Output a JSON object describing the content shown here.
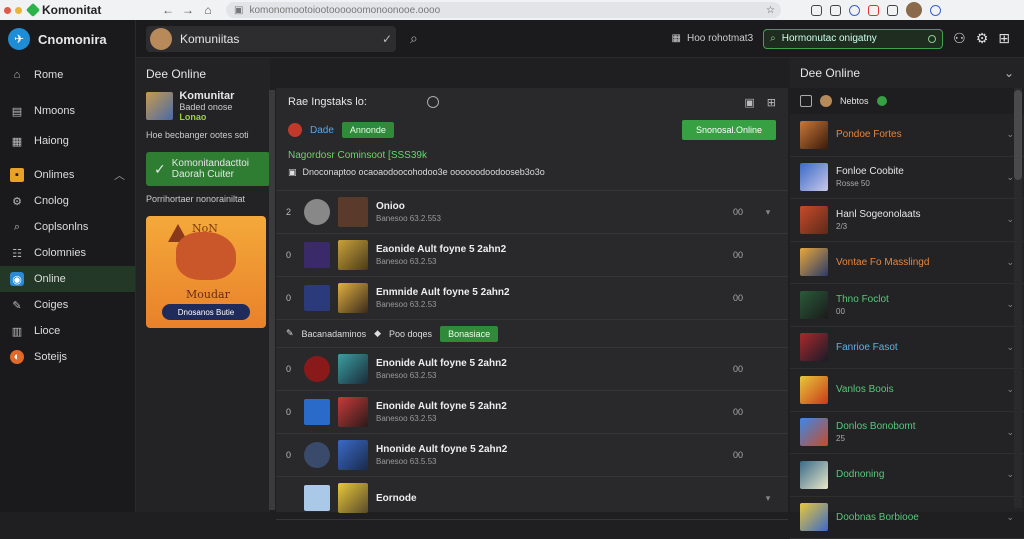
{
  "browser": {
    "tab_title": "Komonitat",
    "url": "komonomootoiootoooooomonoonooe.oooo",
    "dot_colors": [
      "#e05a4a",
      "#e8b53a",
      "#4ac15a"
    ]
  },
  "sidebar": {
    "app_name": "Cnomonira",
    "items": [
      {
        "label": "Rome",
        "icon": "home-icon"
      },
      {
        "label": "Nmoons",
        "icon": "news-icon"
      },
      {
        "label": "Haiong",
        "icon": "calendar-icon"
      },
      {
        "label": "Onlimes",
        "icon": "orange-square-icon"
      },
      {
        "label": "Cnolog",
        "icon": "gear-icon"
      },
      {
        "label": "Coplsonlns",
        "icon": "search-icon"
      },
      {
        "label": "Colomnies",
        "icon": "group-icon"
      },
      {
        "label": "Online",
        "icon": "globe-icon"
      },
      {
        "label": "Coiges",
        "icon": "pin-icon"
      },
      {
        "label": "Lioce",
        "icon": "chart-icon"
      },
      {
        "label": "Soteijs",
        "icon": "coin-icon"
      }
    ]
  },
  "topbar": {
    "search_value": "Komuniitas",
    "status_text": "Hoo rohotmat3",
    "pill_text": "Hormonutac onigatny",
    "accent": "#3fa34d"
  },
  "leftcol": {
    "title": "Dee Online",
    "card_title": "Komunitar",
    "card_sub": "Baded onose",
    "card_sub_highlight": "Lonao",
    "sub1": "Hoe becbanger ootes soti",
    "green_title": "Komonitandacttoi",
    "green_sub": "Daorah Cuiter",
    "sub2": "Porrihortaer nonorainiltat",
    "ad_title": "NoN",
    "ad_sub": "Moudar",
    "ad_button": "Dnosanos Butie"
  },
  "center": {
    "header": "Rae Ingstaks lo:",
    "tag_label": "Dade",
    "tag_badge": "Annonde",
    "main_button": "Snonosal.Online",
    "note_green": "Nagordosr Cominsoot [SSS39k",
    "note_white": "Dnoconaptoo ocaoaodoocohodoo3e oooooodoodooseb3o3o",
    "rows": [
      {
        "num": "2",
        "title": "Onioo",
        "sub": "Banesoo 63.2.553",
        "count": "00"
      },
      {
        "num": "0",
        "title": "Eaonide Ault foyne 5 2ahn2",
        "sub": "Banesoo 63.2.53",
        "count": "00"
      },
      {
        "num": "0",
        "title": "Enmnide Ault foyne 5 2ahn2",
        "sub": "Banesoo 63.2.53",
        "count": "00"
      }
    ],
    "section_label": "Bacanadaminos",
    "section_sub": "Poo doqes",
    "section_badge": "Bonasiace",
    "rows2": [
      {
        "num": "0",
        "title": "Enonide Ault foyne 5 2ahn2",
        "sub": "Banesoo 63.2.53",
        "count": "00"
      },
      {
        "num": "0",
        "title": "Enonide Ault foyne 5 2ahn2",
        "sub": "Banesoo 63.2.53",
        "count": "00"
      },
      {
        "num": "0",
        "title": "Hnonide Ault foyne 5 2ahn2",
        "sub": "Banesoo 63.5.53",
        "count": "00"
      },
      {
        "num": "",
        "title": "Eornode",
        "sub": "",
        "count": ""
      }
    ]
  },
  "rightcol": {
    "title": "Dee Online",
    "sub_label": "Nebtos",
    "items": [
      {
        "title": "Pondoe Fortes",
        "sub": "",
        "color": "#e8843a"
      },
      {
        "title": "Fonloe Coobite",
        "sub": "Rosse 50",
        "color": "#e6e6e6"
      },
      {
        "title": "Hanl Sogeonolaats",
        "sub": "2/3",
        "color": "#e6e6e6"
      },
      {
        "title": "Vontae Fo Masslingd",
        "sub": "",
        "color": "#e8843a"
      },
      {
        "title": "Thno Foclot",
        "sub": "00",
        "color": "#58c77a"
      },
      {
        "title": "Fanrioe Fasot",
        "sub": "",
        "color": "#58b4e8"
      },
      {
        "title": "Vanlos Boois",
        "sub": "",
        "color": "#58c77a"
      },
      {
        "title": "Donlos Bonobomt",
        "sub": "25",
        "color": "#58c77a"
      },
      {
        "title": "Dodnoning",
        "sub": "",
        "color": "#58c77a"
      },
      {
        "title": "Doobnas Borbiooe",
        "sub": "",
        "color": "#58c77a"
      }
    ]
  }
}
